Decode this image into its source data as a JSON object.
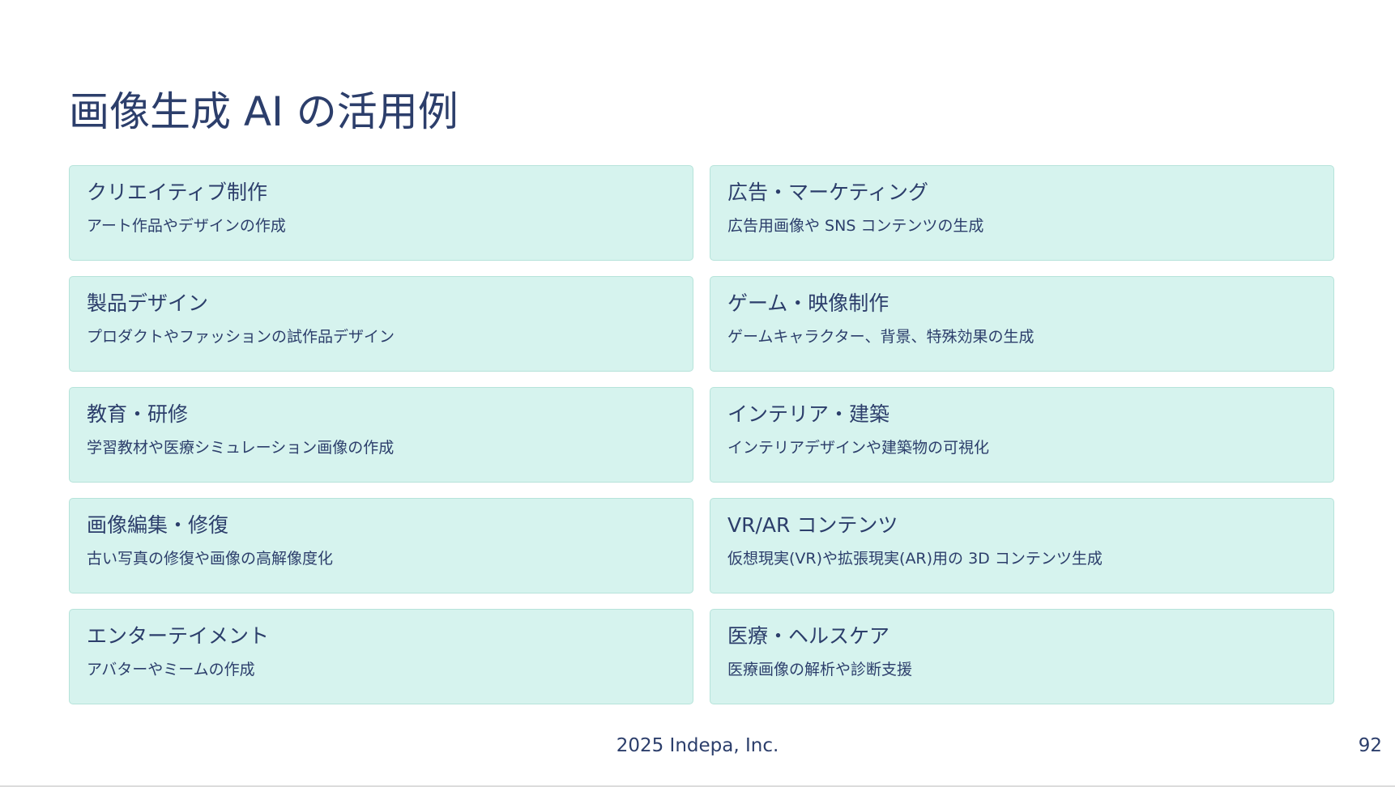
{
  "slide": {
    "title": "画像生成 AI の活用例",
    "cards": [
      {
        "title": "クリエイティブ制作",
        "desc": "アート作品やデザインの作成"
      },
      {
        "title": "広告・マーケティング",
        "desc": "広告用画像や SNS コンテンツの生成"
      },
      {
        "title": "製品デザイン",
        "desc": "プロダクトやファッションの試作品デザイン"
      },
      {
        "title": "ゲーム・映像制作",
        "desc": "ゲームキャラクター、背景、特殊効果の生成"
      },
      {
        "title": "教育・研修",
        "desc": "学習教材や医療シミュレーション画像の作成"
      },
      {
        "title": "インテリア・建築",
        "desc": "インテリアデザインや建築物の可視化"
      },
      {
        "title": "画像編集・修復",
        "desc": "古い写真の修復や画像の高解像度化"
      },
      {
        "title": "VR/AR コンテンツ",
        "desc": "仮想現実(VR)や拡張現実(AR)用の 3D コンテンツ生成"
      },
      {
        "title": "エンターテイメント",
        "desc": "アバターやミームの作成"
      },
      {
        "title": "医療・ヘルスケア",
        "desc": "医療画像の解析や診断支援"
      }
    ],
    "footer": "2025 Indepa, Inc.",
    "page_number": "92"
  },
  "colors": {
    "text": "#2c3e6b",
    "card_background": "#d6f3ee",
    "card_border": "#b6e3da"
  }
}
